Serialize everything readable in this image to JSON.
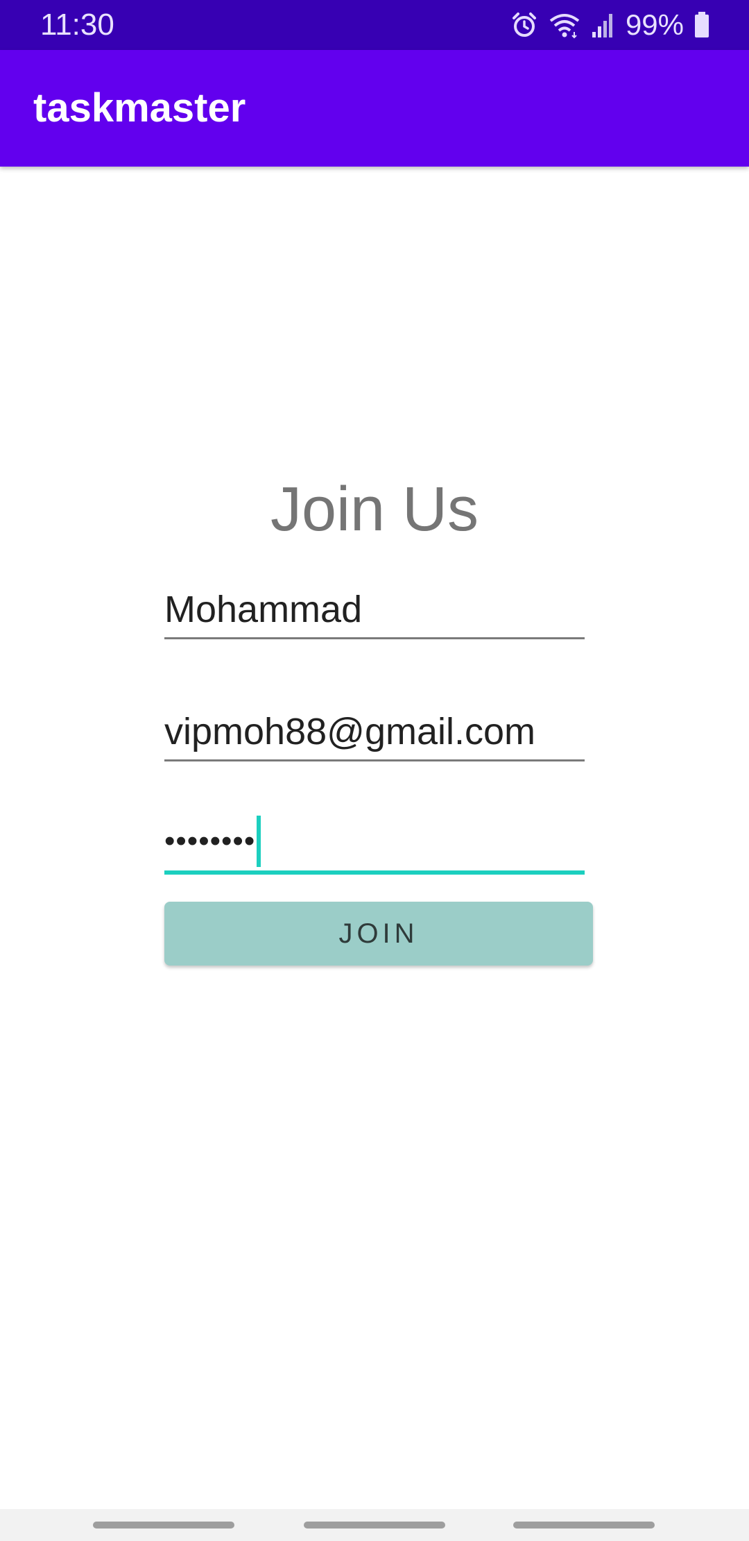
{
  "status_bar": {
    "time": "11:30",
    "battery_percent": "99%",
    "icons": [
      "alarm-icon",
      "wifi-icon",
      "signal-icon",
      "battery-icon"
    ]
  },
  "app_bar": {
    "title": "taskmaster",
    "color": "#6200ee"
  },
  "form": {
    "title": "Join Us",
    "name_value": "Mohammad",
    "email_value": "vipmoh88@gmail.com",
    "password_mask": "••••••••",
    "join_label": "JOIN",
    "accent_color": "#1ccfbf",
    "button_color": "#9bcdc8"
  },
  "nav_bar": {
    "icons": [
      "nav-handle-left",
      "nav-handle-center",
      "nav-handle-right"
    ]
  }
}
